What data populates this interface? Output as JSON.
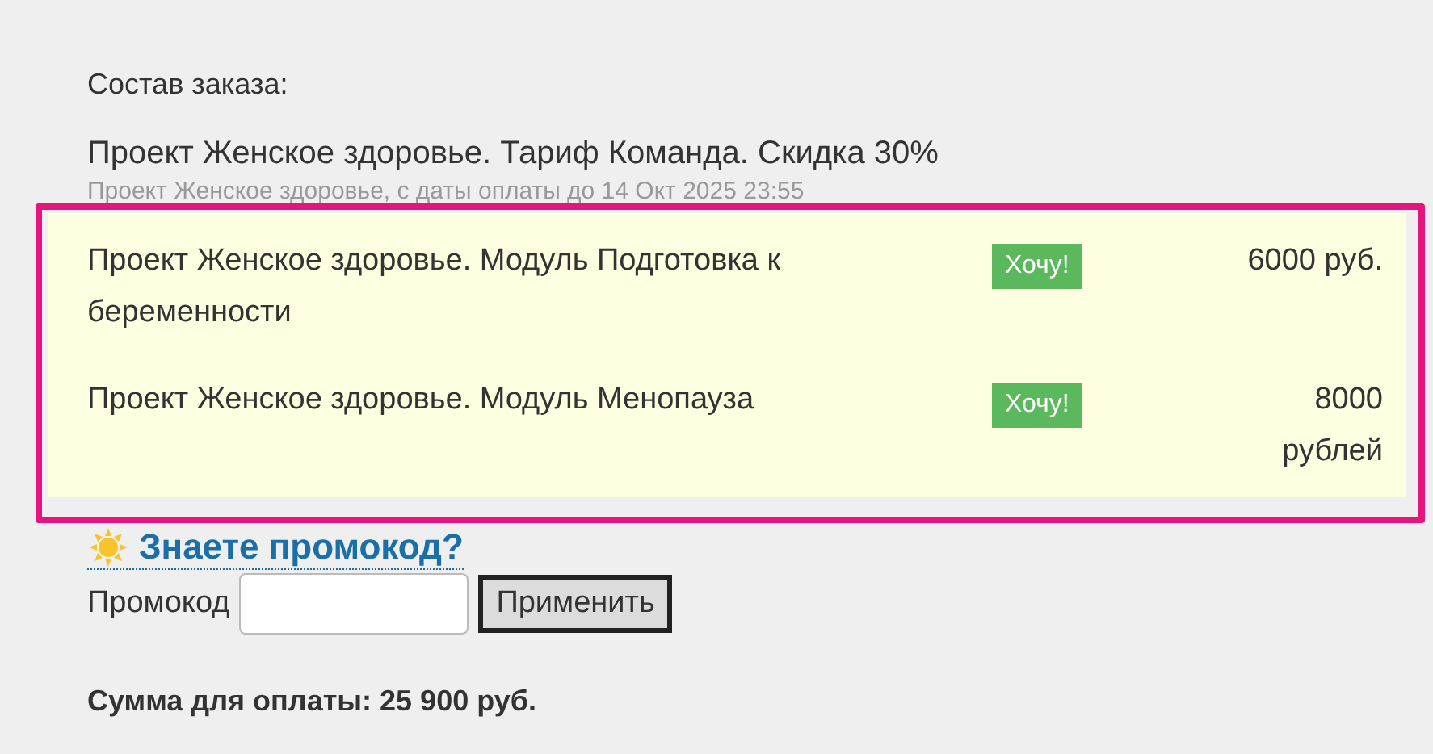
{
  "order": {
    "heading": "Состав заказа:",
    "title": "Проект Женское здоровье. Тариф Команда. Скидка 30%",
    "subtitle": "Проект Женское здоровье, с даты оплаты до 14 Окт 2025 23:55"
  },
  "offers": [
    {
      "name": "Проект Женское здоровье. Модуль Подготовка к беременности",
      "button": "Хочу!",
      "price": "6000 руб."
    },
    {
      "name": "Проект Женское здоровье. Модуль Менопауза",
      "button": "Хочу!",
      "price": "8000 рублей"
    }
  ],
  "promo": {
    "link": "Знаете промокод?",
    "label": "Промокод",
    "button": "Применить"
  },
  "total": "Сумма для оплаты: 25 900 руб."
}
